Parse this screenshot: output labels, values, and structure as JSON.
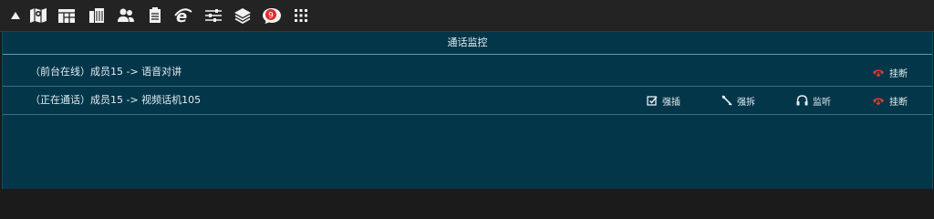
{
  "toolbar": {
    "icons": [
      "collapse-arrow-icon",
      "map-icon",
      "window-icon",
      "building-icon",
      "contacts-icon",
      "document-icon",
      "ie-browser-icon",
      "sliders-icon",
      "layers-icon",
      "chat-icon",
      "grid-icon"
    ],
    "badge_count": "9",
    "colors": {
      "bg": "#232323",
      "icon": "#f2f2f2",
      "badge": "#e02b2b"
    }
  },
  "panel": {
    "title": "通话监控",
    "colors": {
      "bg": "#04364a",
      "divider": "#3e6e81",
      "hangup_icon": "#e23b2f"
    }
  },
  "calls": [
    {
      "text": "（前台在线）成员15 -> 语音对讲",
      "actions": {
        "hangup": "挂断"
      }
    },
    {
      "text": "（正在通话）成员15 -> 视频话机105",
      "actions": {
        "barge": "强插",
        "split": "强拆",
        "monitor": "监听",
        "hangup": "挂断"
      }
    }
  ]
}
